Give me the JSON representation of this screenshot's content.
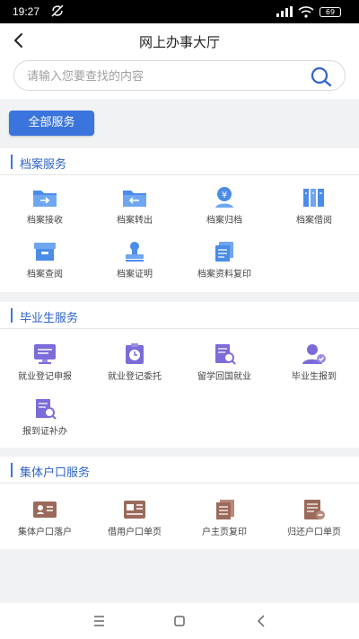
{
  "status_bar": {
    "time": "19:27",
    "battery": "69"
  },
  "header": {
    "title": "网上办事大厅"
  },
  "search": {
    "placeholder": "请输入您要查找的内容"
  },
  "all_services_label": "全部服务",
  "sections": [
    {
      "title": "档案服务",
      "items": [
        {
          "label": "档案接收",
          "icon": "folder-receive-icon"
        },
        {
          "label": "档案转出",
          "icon": "folder-transfer-icon"
        },
        {
          "label": "档案归档",
          "icon": "archive-person-icon"
        },
        {
          "label": "档案借阅",
          "icon": "books-icon"
        },
        {
          "label": "档案查阅",
          "icon": "box-icon"
        },
        {
          "label": "档案证明",
          "icon": "stamp-icon"
        },
        {
          "label": "档案资料复印",
          "icon": "copy-icon"
        }
      ]
    },
    {
      "title": "毕业生服务",
      "items": [
        {
          "label": "就业登记申报",
          "icon": "monitor-icon"
        },
        {
          "label": "就业登记委托",
          "icon": "clipboard-clock-icon"
        },
        {
          "label": "留学回国就业",
          "icon": "document-search-icon"
        },
        {
          "label": "毕业生报到",
          "icon": "user-check-icon"
        },
        {
          "label": "报到证补办",
          "icon": "document-search-icon"
        }
      ]
    },
    {
      "title": "集体户口服务",
      "items": [
        {
          "label": "集体户口落户",
          "icon": "id-card-icon"
        },
        {
          "label": "借用户口单页",
          "icon": "card-page-icon"
        },
        {
          "label": "户主页复印",
          "icon": "stacked-pages-icon"
        },
        {
          "label": "归还户口单页",
          "icon": "return-page-icon"
        }
      ]
    }
  ],
  "colors": {
    "accent": "#3a74dc",
    "icon_blue": "#4a8ce8",
    "icon_purple": "#7b6cd9",
    "icon_brown": "#9b6a5a"
  }
}
